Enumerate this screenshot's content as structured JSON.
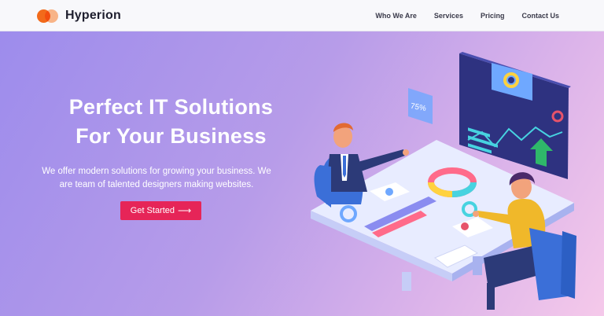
{
  "brand": {
    "name": "Hyperion",
    "logo_icon": "overlapping-circles-logo",
    "colors": [
      "#f26a1b",
      "#ffb98a"
    ]
  },
  "nav": {
    "links": [
      "Who We Are",
      "Services",
      "Pricing",
      "Contact Us"
    ]
  },
  "hero": {
    "headline_line1": "Perfect IT Solutions",
    "headline_line2": "For Your Business",
    "subtext_line1": "We offer modern solutions for growing your business. We",
    "subtext_line2": "are team of talented designers making websites.",
    "cta_label": "Get Started",
    "cta_icon": "arrow-right-icon",
    "cta_color": "#e62558",
    "background_gradient": [
      "#9d8cec",
      "#dbb3ea",
      "#f5c9ea"
    ]
  },
  "illustration": {
    "gauge_label": "75%",
    "description_icon": "business-meeting-illustration"
  }
}
